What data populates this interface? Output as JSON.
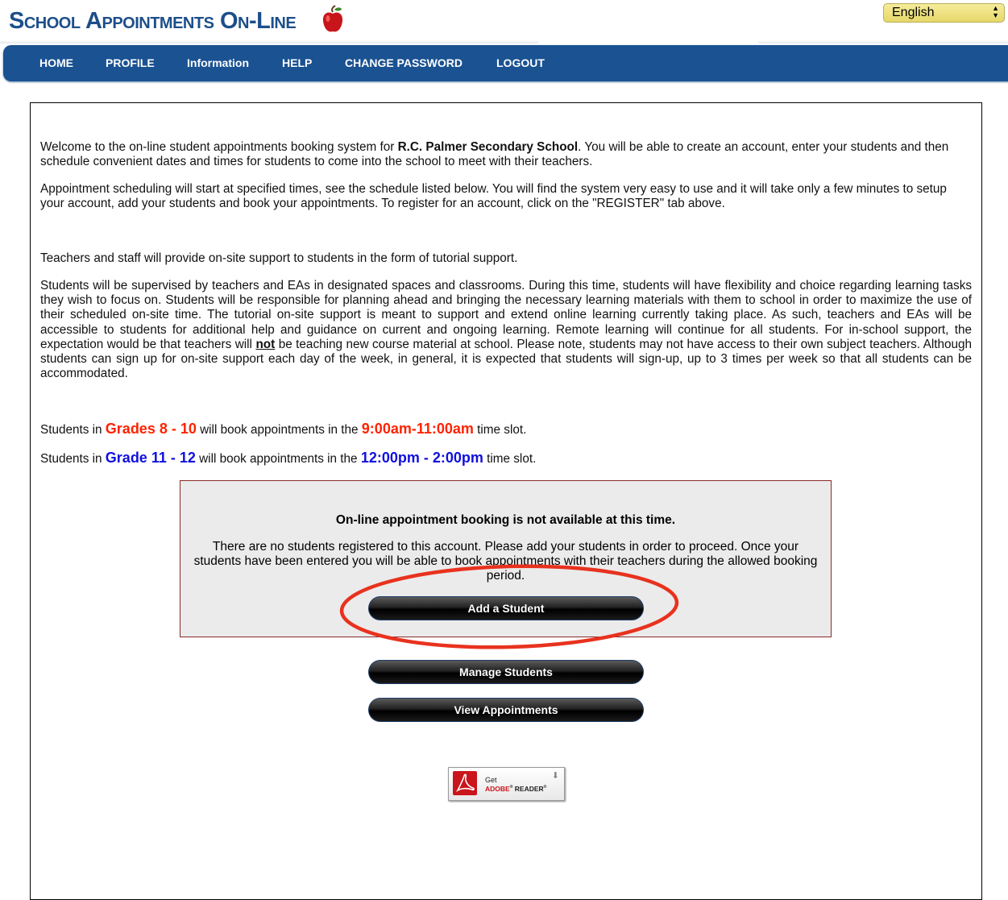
{
  "header": {
    "logo_text": "School Appointments On-Line",
    "language": {
      "selected": "English"
    }
  },
  "nav": {
    "items": [
      {
        "label": "HOME"
      },
      {
        "label": "PROFILE"
      },
      {
        "label": "Information"
      },
      {
        "label": "HELP"
      },
      {
        "label": "CHANGE PASSWORD"
      },
      {
        "label": "LOGOUT"
      }
    ]
  },
  "content": {
    "welcome": {
      "before": "Welcome to the on-line student appointments booking system for ",
      "school": "R.C. Palmer Secondary School",
      "after": ". You will be able to create an account, enter your students and then schedule convenient dates and times for students to come into the school to meet with their teachers."
    },
    "scheduling": "Appointment scheduling will start at specified times, see the schedule listed below. You will find the system very easy to use and it will take only a few minutes to setup your account, add your students and book your appointments. To register for an account, click on the \"REGISTER\" tab above.",
    "support": "Teachers and staff will provide on-site support to students in the form of tutorial support.",
    "supervision": {
      "before": "Students will be supervised by teachers and EAs in designated spaces and classrooms.  During this time, students will have flexibility and choice regarding learning tasks they wish to focus on.  Students will be responsible for planning ahead and bringing the necessary learning materials with them to school in order to maximize the use of their scheduled on-site time. The tutorial on-site support is meant to support and extend online learning currently taking place. As such, teachers and EAs will be accessible to students for additional help and guidance on current and ongoing learning.  Remote learning will continue for all students.  For in-school support, the expectation would be that teachers will ",
      "emphasis": "not",
      "after": " be teaching new course material at school.  Please note, students may not have access to their own subject teachers. Although students can sign up for on-site support each day of the week, in general, it is expected that students will sign-up, up to 3 times per week so that all students can be accommodated."
    },
    "slot1": {
      "prefix": "Students in ",
      "grades": "Grades 8 - 10",
      "middle": " will book appointments in the ",
      "time": "9:00am-11:00am",
      "suffix": " time slot."
    },
    "slot2": {
      "prefix": "Students in ",
      "grades": "Grade 11 - 12",
      "middle": " will book appointments in the ",
      "time": "12:00pm - 2:00pm",
      "suffix": " time slot."
    }
  },
  "notice": {
    "title": "On-line appointment booking is not available at this time.",
    "body": "There are no students registered to this account. Please add your students in order to proceed. Once your students have been entered you will be able to book appointments with their teachers during the allowed booking period."
  },
  "buttons": {
    "add_student": "Add a Student",
    "manage_students": "Manage Students",
    "view_appointments": "View Appointments"
  },
  "adobe": {
    "get": "Get",
    "brand": "ADOBE",
    "reader": "READER"
  },
  "colors": {
    "nav_blue": "#1a5292",
    "logo_blue": "#1c4f8a",
    "grade_red": "#ff2200",
    "grade_blue": "#1010e0",
    "highlight_red": "#e8321e"
  }
}
